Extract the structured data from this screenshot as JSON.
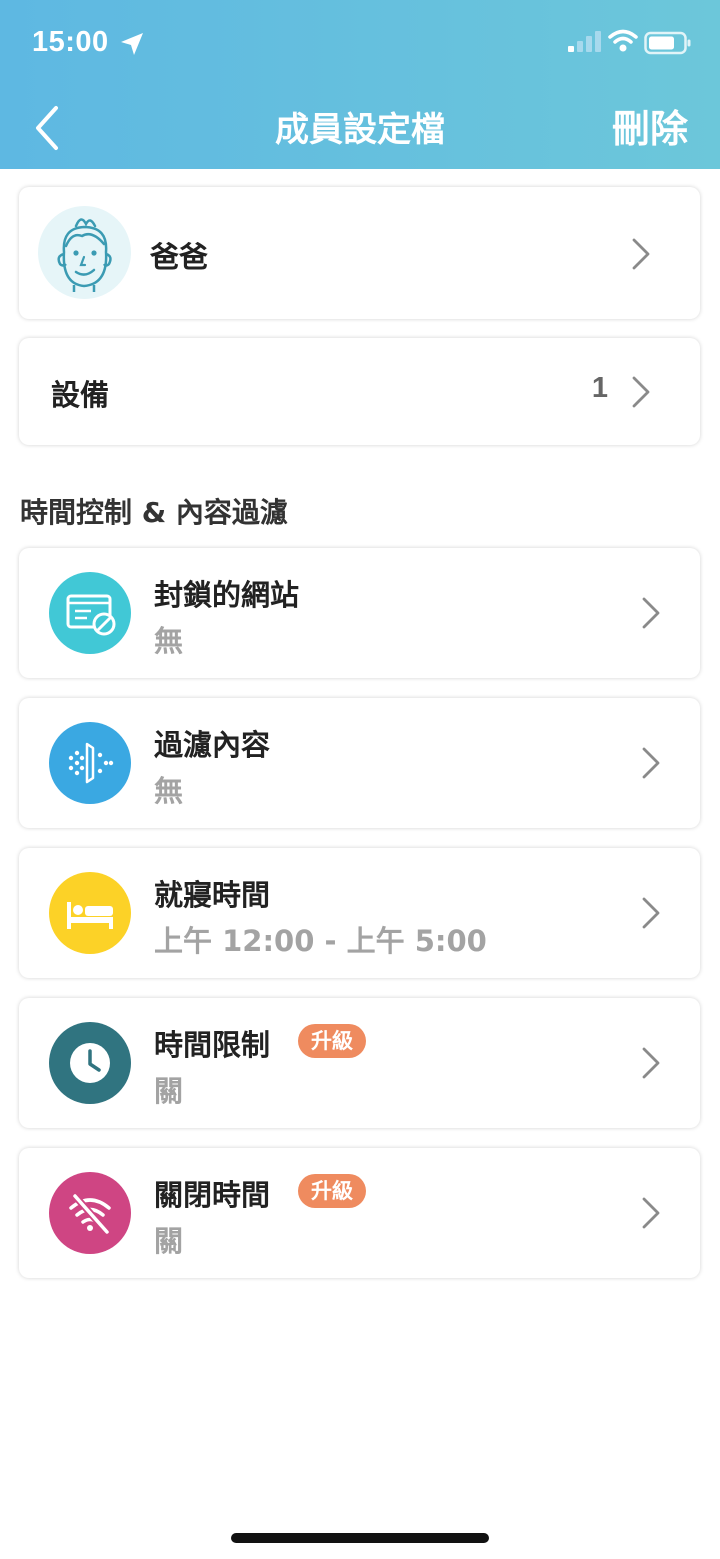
{
  "status_bar": {
    "time": "15:00"
  },
  "nav": {
    "title": "成員設定檔",
    "delete_label": "刪除"
  },
  "profile": {
    "name": "爸爸"
  },
  "devices": {
    "label": "設備",
    "count": "1"
  },
  "section": {
    "title": "時間控制 & 內容過濾"
  },
  "features": [
    {
      "title": "封鎖的網站",
      "subtitle": "無",
      "icon": "blocked-website-icon",
      "color": "#41c8d6"
    },
    {
      "title": "過濾內容",
      "subtitle": "無",
      "icon": "content-filter-icon",
      "color": "#3aa8e2"
    },
    {
      "title": "就寢時間",
      "subtitle": "上午 12:00 - 上午 5:00",
      "icon": "bed-icon",
      "color": "#fcd227"
    },
    {
      "title": "時間限制",
      "subtitle": "關",
      "badge": "升級",
      "icon": "clock-icon",
      "color": "#307480"
    },
    {
      "title": "關閉時間",
      "subtitle": "關",
      "badge": "升級",
      "icon": "wifi-off-icon",
      "color": "#cf4583"
    }
  ]
}
